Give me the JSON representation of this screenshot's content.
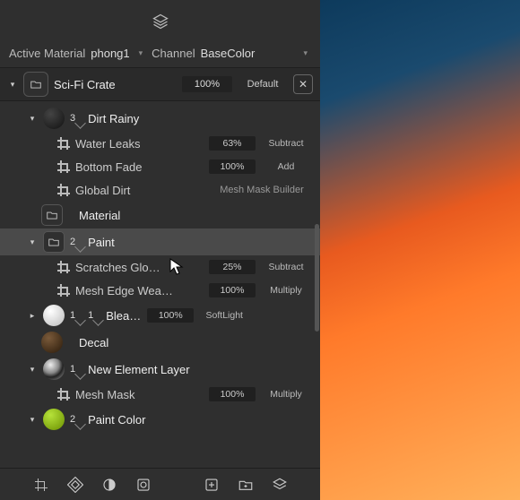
{
  "selectors": {
    "material_lbl": "Active Material",
    "material_val": "phong1",
    "channel_lbl": "Channel",
    "channel_val": "BaseColor"
  },
  "root": {
    "name": "Sci-Fi Crate",
    "opacity": "100%",
    "blend": "Default"
  },
  "layers": {
    "dirt": {
      "badge": "3",
      "name": "Dirt Rainy"
    },
    "waterleaks": {
      "name": "Water Leaks",
      "pct": "63%",
      "blend": "Subtract"
    },
    "bottomfade": {
      "name": "Bottom Fade",
      "pct": "100%",
      "blend": "Add"
    },
    "globaldirt": {
      "name": "Global Dirt",
      "blend": "Mesh Mask Builder"
    },
    "material": {
      "name": "Material"
    },
    "paint": {
      "badge": "2",
      "name": "Paint"
    },
    "scratches": {
      "name": "Scratches Glo…",
      "pct": "25%",
      "blend": "Subtract"
    },
    "meshedge": {
      "name": "Mesh Edge Wea…",
      "pct": "100%",
      "blend": "Multiply"
    },
    "blea": {
      "badge1": "1",
      "badge2": "1",
      "name": "Blea…",
      "pct": "100%",
      "blend": "SoftLight"
    },
    "decal": {
      "name": "Decal"
    },
    "newelem": {
      "badge": "1",
      "name": "New Element Layer"
    },
    "meshmask": {
      "name": "Mesh Mask",
      "pct": "100%",
      "blend": "Multiply"
    },
    "paintcolor": {
      "badge": "2",
      "name": "Paint Color"
    }
  }
}
